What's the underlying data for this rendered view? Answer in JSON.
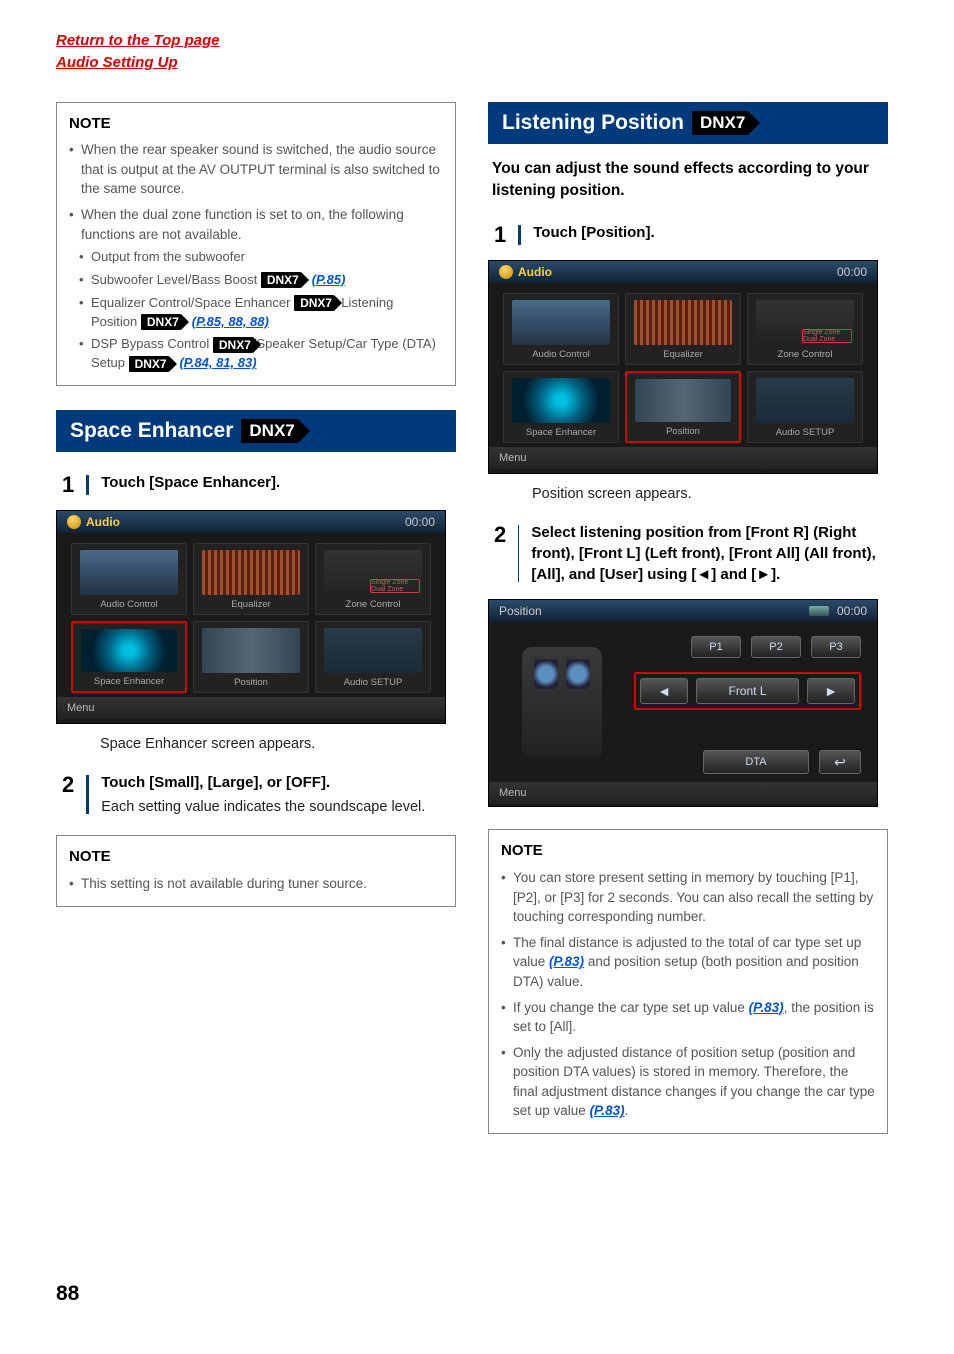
{
  "top_links": {
    "return": "Return to the Top page",
    "section": "Audio Setting Up"
  },
  "left": {
    "note1": {
      "title": "NOTE",
      "items": [
        "When the rear speaker sound is switched, the audio source that is output at the AV OUTPUT terminal is also switched to the same source.",
        "When the dual zone function is set to on, the following functions are not available."
      ],
      "sub": {
        "a": "Output from the subwoofer",
        "b_pre": "Subwoofer Level/Bass Boost ",
        "b_ref": "(P.85)",
        "c_pre": "Equalizer Control/Space Enhancer ",
        "c_mid": "/ Listening Position ",
        "c_ref": "(P.85, 88, 88)",
        "d_pre": "DSP Bypass Control ",
        "d_mid": "/Speaker Setup/Car Type (DTA) Setup ",
        "d_ref": "(P.84, 81, 83)"
      }
    },
    "section_title": "Space Enhancer",
    "badge": "DNX7",
    "step1": "Touch [Space Enhancer].",
    "caption1": "Space Enhancer screen appears.",
    "step2_bold": "Touch [Small], [Large], or [OFF].",
    "step2_body": "Each setting value indicates the soundscape level.",
    "note2": {
      "title": "NOTE",
      "item": "This setting is not available during tuner source."
    },
    "ss": {
      "hdr": "Audio",
      "time": "00:00",
      "cells": [
        "Audio Control",
        "Equalizer",
        "Zone Control",
        "Space Enhancer",
        "Position",
        "Audio SETUP"
      ],
      "dz": "Single Zone   Dual Zone",
      "menu": "Menu"
    }
  },
  "right": {
    "section_title": "Listening Position",
    "badge": "DNX7",
    "intro": "You can adjust the sound effects according to your listening position.",
    "step1": "Touch [Position].",
    "caption1": "Position screen appears.",
    "step2": "Select listening position from [Front R] (Right front), [Front L] (Left front), [Front All] (All front), [All], and [User] using [◄] and [►].",
    "ss": {
      "hdr": "Audio",
      "time": "00:00",
      "cells": [
        "Audio Control",
        "Equalizer",
        "Zone Control",
        "Space Enhancer",
        "Position",
        "Audio SETUP"
      ],
      "dz": "Single Zone   Dual Zone",
      "menu": "Menu"
    },
    "pos": {
      "hdr": "Position",
      "time": "00:00",
      "p1": "P1",
      "p2": "P2",
      "p3": "P3",
      "left": "◄",
      "value": "Front L",
      "right": "►",
      "dta": "DTA",
      "back": "↩",
      "menu": "Menu"
    },
    "note": {
      "title": "NOTE",
      "a": "You can store present setting in memory by touching [P1], [P2], or [P3] for 2 seconds. You can also recall the setting by touching corresponding number.",
      "b_pre": "The final distance is adjusted to the total of car type set up value ",
      "b_ref": "(P.83)",
      "b_post": " and position setup (both position and position DTA) value.",
      "c_pre": "If you change the car type set up value ",
      "c_ref": "(P.83)",
      "c_post": ", the position is set to [All].",
      "d_pre": "Only the adjusted distance of position setup (position and position DTA values) is stored in memory. Therefore, the final adjustment distance changes if you change the car type set up value ",
      "d_ref": "(P.83)",
      "d_post": "."
    }
  },
  "page_num": "88"
}
